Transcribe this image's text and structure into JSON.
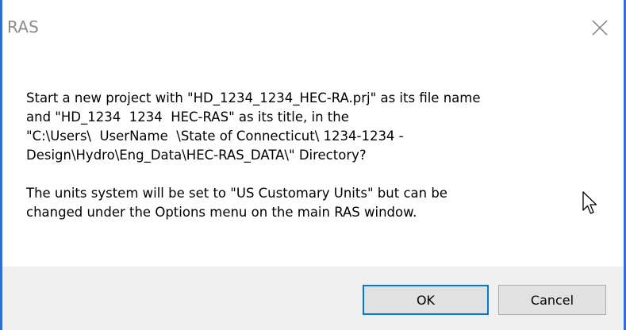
{
  "window": {
    "title": "RAS"
  },
  "message": {
    "lines_para1": [
      "Start a new project with \"HD_1234_1234_HEC-RA.prj\" as its file name",
      "and \"HD_1234  1234  HEC-RAS\" as its title, in the",
      "\"C:\\Users\\  UserName  \\State of Connecticut\\ 1234-1234 -",
      "Design\\Hydro\\Eng_Data\\HEC-RAS_DATA\\\" Directory?"
    ],
    "lines_para2": [
      "The units system will be set to \"US Customary Units\" but can be",
      "changed under the Options menu on the main RAS window."
    ]
  },
  "buttons": {
    "ok_label": "OK",
    "cancel_label": "Cancel"
  },
  "icons": {
    "close": "close-icon",
    "cursor": "mouse-pointer-icon"
  },
  "colors": {
    "window_border": "#2f6ed4",
    "footer_bg": "#f0f0f0",
    "default_button_border": "#0078d7"
  }
}
